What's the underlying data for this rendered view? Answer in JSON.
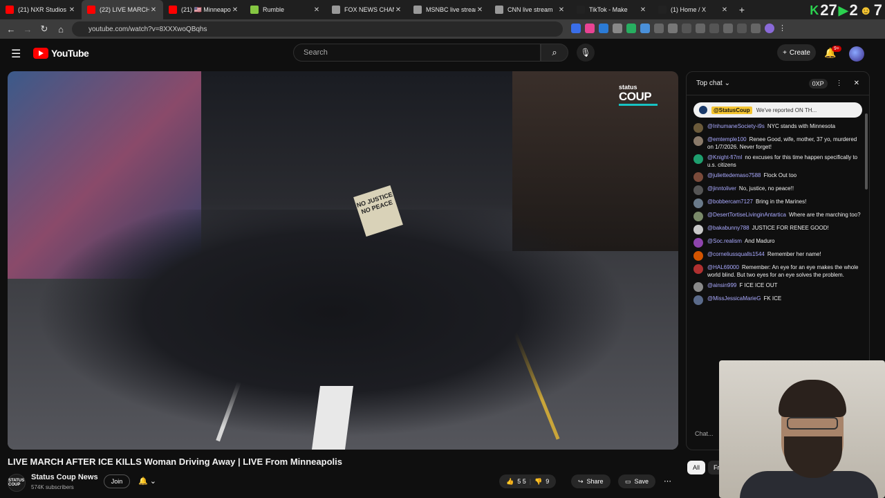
{
  "browser": {
    "tabs": [
      {
        "title": "(21) NXR Studios -",
        "favicon_color": "#ff0000",
        "active": false
      },
      {
        "title": "(22) LIVE MARCH A",
        "favicon_color": "#ff0000",
        "active": true
      },
      {
        "title": "(21) 🇺🇸 Minneapolis",
        "favicon_color": "#ff0000",
        "active": false
      },
      {
        "title": "Rumble",
        "favicon_color": "#85c742",
        "active": false
      },
      {
        "title": "FOX NEWS CHANN",
        "favicon_color": "#999999",
        "active": false
      },
      {
        "title": "MSNBC live stream",
        "favicon_color": "#999999",
        "active": false
      },
      {
        "title": "CNN live stream",
        "favicon_color": "#999999",
        "active": false
      },
      {
        "title": "TikTok - Make",
        "favicon_color": "#222222",
        "active": false
      },
      {
        "title": "(1) Home / X",
        "favicon_color": "#222222",
        "active": false
      }
    ],
    "new_tab": "+",
    "overlay_numbers": [
      "27",
      "2",
      "7"
    ],
    "url": "youtube.com/watch?v=8XXXwoQBqhs"
  },
  "youtube": {
    "logo_text": "YouTube",
    "search_placeholder": "Search",
    "create_label": "Create",
    "notif_badge": "9+"
  },
  "video": {
    "watermark_top": "status",
    "watermark_bottom": "COUP",
    "sign_text": "NO JUSTICE NO PEACE",
    "title": "LIVE MARCH AFTER ICE KILLS Woman Driving Away | LIVE From Minneapolis",
    "channel_name": "Status Coup News",
    "channel_avatar_text": "STATUS COUP",
    "subscribers": "574K subscribers",
    "join_label": "Join",
    "likes": "5 5",
    "dislikes": "9",
    "share_label": "Share",
    "save_label": "Save"
  },
  "chat": {
    "header": "Top chat",
    "xp": "0XP",
    "pinned_user": "@StatusCoup",
    "pinned_text": "We've reported ON TH...",
    "messages": [
      {
        "user": "@InhumaneSociety-i9s",
        "text": "NYC stands with Minnesota",
        "color": "#6b5a3a"
      },
      {
        "user": "@emtemple100",
        "text": "Renee Good, wife, mother, 37 yo, murdered on 1/7/2026. Never forget!",
        "color": "#8a7a6a"
      },
      {
        "user": "@Knight-fi7ml",
        "text": "no excuses for this time happen specifically to u.s. citizens",
        "color": "#1e9e6e"
      },
      {
        "user": "@juliettedemaso7588",
        "text": "Flock Out too",
        "color": "#7a4a3a"
      },
      {
        "user": "@jinntoliver",
        "text": "No, justice, no peace!!",
        "color": "#555555"
      },
      {
        "user": "@bobbercam7127",
        "text": "Bring in the Marines!",
        "color": "#6a7a8a"
      },
      {
        "user": "@DesertTortiseLivinginAntartica",
        "text": "Where are the marching too?",
        "color": "#7a8a6a"
      },
      {
        "user": "@bakabunny788",
        "text": "JUSTICE FOR RENEE GOOD!",
        "color": "#c8c8c8"
      },
      {
        "user": "@Soc.realism",
        "text": "And Maduro",
        "color": "#8e44ad"
      },
      {
        "user": "@corneliussqualls1544",
        "text": "Remember her name!",
        "color": "#d35400"
      },
      {
        "user": "@HAL69000",
        "text": "Remember: An eye for an eye makes the whole world blind. But two eyes for an eye solves the problem.",
        "color": "#b03030"
      },
      {
        "user": "@ainsin999",
        "text": "F ICE ICE OUT",
        "color": "#8a8a8a"
      },
      {
        "user": "@MissJessicaMarieG",
        "text": "FK ICE",
        "color": "#5a6a8a"
      }
    ],
    "input_placeholder": "Chat..."
  },
  "chips": {
    "all": "All",
    "from": "Fr"
  }
}
